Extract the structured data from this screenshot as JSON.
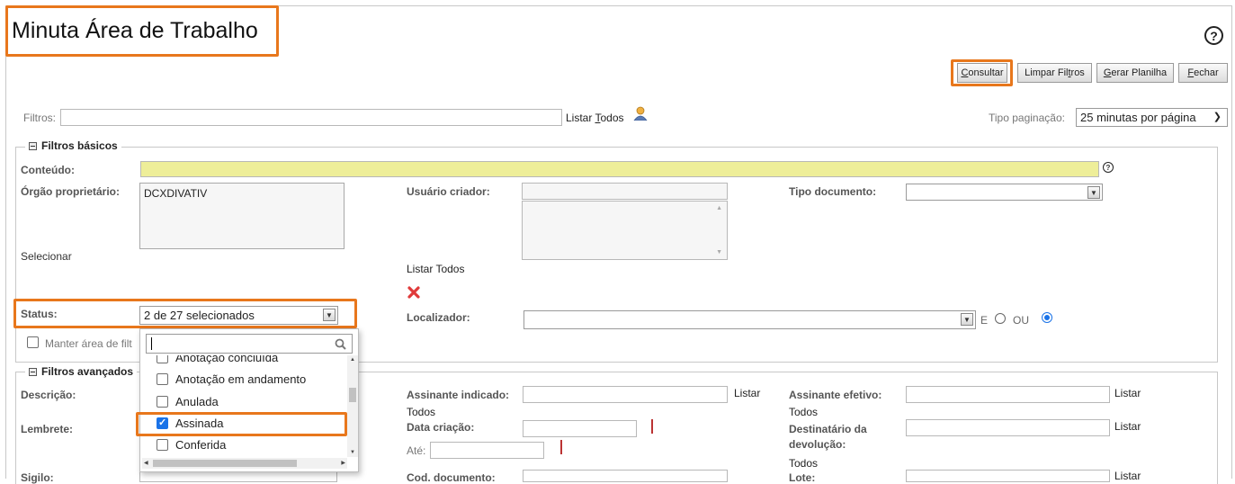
{
  "page": {
    "title": "Minuta Área de Trabalho",
    "help_icon": "question-circle-icon",
    "accent_color": "#e8771c"
  },
  "toolbar": {
    "consultar_pre": "",
    "consultar_u": "C",
    "consultar_post": "onsultar",
    "limpar_pre": "Limpar Fil",
    "limpar_u": "t",
    "limpar_post": "ros",
    "gerar_pre": "",
    "gerar_u": "G",
    "gerar_post": "erar Planilha",
    "fechar_pre": "",
    "fechar_u": "F",
    "fechar_post": "echar"
  },
  "filters_row": {
    "label": "Filtros:",
    "value": "",
    "listar_pre": "Listar ",
    "listar_u": "T",
    "listar_post": "odos",
    "user_icon": "user-icon",
    "paginacao_label": "Tipo paginação:",
    "paginacao_value": "25 minutas por página"
  },
  "basicos": {
    "legend": "Filtros básicos",
    "conteudo_label": "Conteúdo:",
    "conteudo_value": "",
    "conteudo_highlight": "#eeee99",
    "orgao_label": "Órgão proprietário:",
    "orgao_value": "DCXDIVATIV",
    "selecionar": "Selecionar",
    "usuario_label": "Usuário criador:",
    "usuario_listar": "Listar Todos",
    "remove_icon": "red-x-icon",
    "tipo_label": "Tipo documento:",
    "status_label": "Status:",
    "status_value": "2 de 27 selecionados",
    "localizador_label": "Localizador:",
    "localizador_e": "E",
    "localizador_ou": "OU",
    "manter_label": "Manter área de filt"
  },
  "status_dropdown": {
    "search_value": "",
    "items": [
      {
        "label": "Anotação concluída",
        "checked": false
      },
      {
        "label": "Anotação em andamento",
        "checked": false
      },
      {
        "label": "Anulada",
        "checked": false
      },
      {
        "label": "Assinada",
        "checked": true
      },
      {
        "label": "Conferida",
        "checked": false
      }
    ]
  },
  "avancados": {
    "legend": "Filtros avançados",
    "descricao_label": "Descrição:",
    "lembrete_label": "Lembrete:",
    "sigilo_label": "Sigilo:",
    "assinante_ind_label": "Assinante indicado:",
    "assinante_ind_listar": "Listar",
    "assinante_ind_todos": "Todos",
    "data_criacao_label": "Data criação:",
    "ate_label": "Até:",
    "cod_doc_label": "Cod. documento:",
    "assinante_ef_label": "Assinante efetivo:",
    "assinante_ef_listar": "Listar",
    "assinante_ef_todos": "Todos",
    "destinatario_label_1": "Destinatário da",
    "destinatario_label_2": "devolução:",
    "destinatario_listar": "Listar",
    "destinatario_todos": "Todos",
    "lote_label": "Lote:",
    "lote_listar": "Listar"
  }
}
